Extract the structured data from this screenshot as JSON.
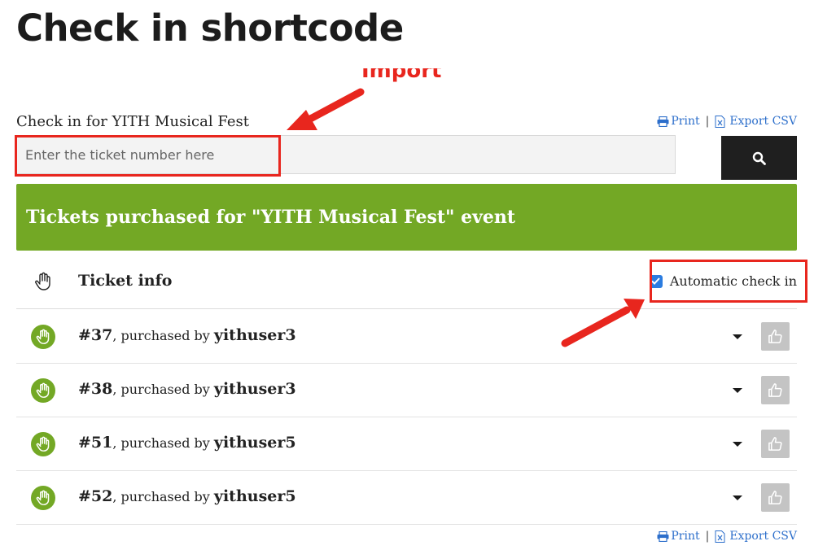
{
  "page": {
    "title": "Check in shortcode"
  },
  "annotation": {
    "text": "Import"
  },
  "checkin": {
    "label": "Check in for YITH Musical Fest",
    "placeholder": "Enter the ticket number here"
  },
  "links": {
    "print": "Print",
    "separator": "|",
    "export": "Export CSV"
  },
  "banner": {
    "title": "Tickets purchased for \"YITH Musical Fest\" event"
  },
  "table": {
    "header_label": "Ticket info",
    "auto_checkin_label": "Automatic check in",
    "auto_checkin_checked": true,
    "rows": [
      {
        "number": "#37",
        "purchased_by": ", purchased by ",
        "user": "yithuser3"
      },
      {
        "number": "#38",
        "purchased_by": ", purchased by ",
        "user": "yithuser3"
      },
      {
        "number": "#51",
        "purchased_by": ", purchased by ",
        "user": "yithuser5"
      },
      {
        "number": "#52",
        "purchased_by": ", purchased by ",
        "user": "yithuser5"
      }
    ]
  },
  "colors": {
    "accent_green": "#73a825",
    "annotation_red": "#e8261e",
    "link_blue": "#2d6fcb",
    "button_dark": "#1f1f1f"
  },
  "icons": {
    "search": "search-icon",
    "print": "printer-icon",
    "export": "csv-file-icon",
    "hand": "hand-icon",
    "like": "thumbs-up-icon",
    "caret": "caret-down-icon"
  }
}
